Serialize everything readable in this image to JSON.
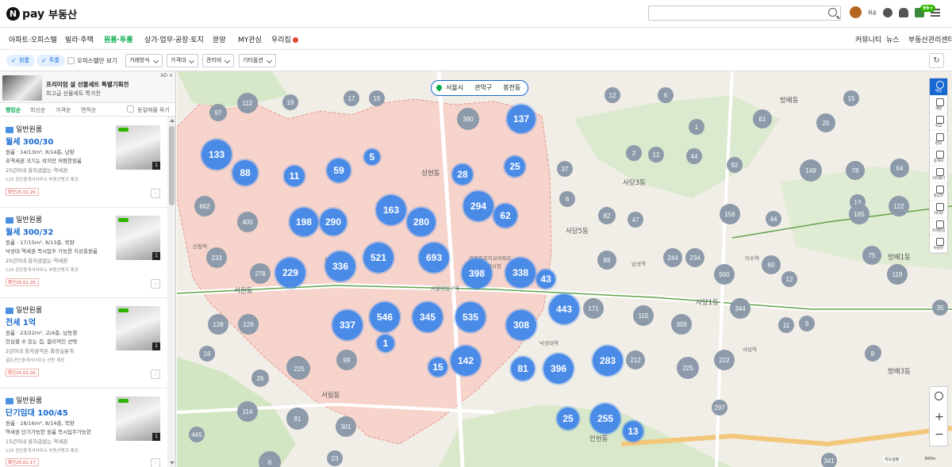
{
  "header": {
    "logo_n": "N",
    "logo_pay": "pay",
    "service": "부동산",
    "user_name": "휘슬",
    "mail_badge": "99+"
  },
  "nav": {
    "tabs": [
      "아파트·오피스텔",
      "빌라·주택",
      "원룸·투룸",
      "상가·업무·공장·토지",
      "분양",
      "MY관심",
      "우리집"
    ],
    "active_tab": "원룸·투룸",
    "right_links": [
      "커뮤니티",
      "뉴스",
      "부동산관리센터"
    ]
  },
  "filters": {
    "chips": [
      "원룸",
      "투룸"
    ],
    "officetel_only": "오피스텔만 보기",
    "dropdowns": [
      "거래방식",
      "가격대",
      "관리비",
      "기타옵션"
    ]
  },
  "ad": {
    "title": "프리미엄 설 선물세트 특별기획전",
    "subtitle": "최고급 선물세트 특가전",
    "tag": "AD ✕"
  },
  "sort": {
    "options": [
      "랭킹순",
      "최신순",
      "가격순",
      "면적순"
    ],
    "active": "랭킹순",
    "group_label": "동일매물 묶기"
  },
  "listings": [
    {
      "badge": "원룸",
      "type": "일반원룸",
      "price": "월세 300/30",
      "spec": "원룸 · 14/13m², 8/14층, 남향",
      "desc": "초역세권 크기는 작지만 저렴한원룸",
      "tags": "25년이내   융자금없는   역세권",
      "agent": "123 공인중개사사무소   부동산뱅크 제공",
      "confirmed": "확인25.01.20.",
      "photo_count": "1"
    },
    {
      "badge": "원룸",
      "type": "일반원룸",
      "price": "월세 300/32",
      "spec": "원룸 · 17/15m², 8/13층, 북향",
      "desc": "낙성대 역세권 즉시입주 가능한 지상층원룸",
      "tags": "25년이내   융자금없는   역세권",
      "agent": "123 공인중개사사무소   부동산뱅크 제공",
      "confirmed": "확인25.01.20.",
      "photo_count": "1"
    },
    {
      "badge": "원룸",
      "type": "일반원룸",
      "price": "전세 1억",
      "spec": "원룸 · 23/22m², 고/4층, 남동향",
      "desc": "안심할 수 있는 집, 합리적인 선택",
      "tags": "2년이내   융자금적은   화장실분개",
      "agent": "골든공인중개사사무소   선방 제공",
      "confirmed": "확인25.01.20.",
      "photo_count": "1"
    },
    {
      "badge": "원룸",
      "type": "일반원룸",
      "price": "단기임대 100/45",
      "spec": "원룸 · 18/16m², 8/14층, 북향",
      "desc": "역세권 단기가능한 원룸 즉시입주가능한",
      "tags": "15년이내   융자금없는   역세권",
      "agent": "123 공인중개사사무소   부동산뱅크 제공",
      "confirmed": "확인25.01.17.",
      "photo_count": "1"
    }
  ],
  "map": {
    "location": [
      "서울시",
      "관악구",
      "봉천동"
    ],
    "clusters_blue": [
      "133",
      "88",
      "11",
      "59",
      "5",
      "28",
      "137",
      "25",
      "198",
      "290",
      "163",
      "280",
      "294",
      "62",
      "229",
      "336",
      "521",
      "693",
      "398",
      "338",
      "43",
      "337",
      "546",
      "345",
      "535",
      "308",
      "443",
      "1",
      "15",
      "142",
      "81",
      "396",
      "283",
      "25",
      "255",
      "13"
    ],
    "clusters_gray": [
      "390",
      "97",
      "112",
      "19",
      "17",
      "15",
      "37",
      "12",
      "2",
      "12",
      "6",
      "1",
      "61",
      "20",
      "15",
      "13",
      "662",
      "400",
      "233",
      "278",
      "6",
      "82",
      "47",
      "44",
      "92",
      "149",
      "78",
      "64",
      "156",
      "44",
      "165",
      "122",
      "129",
      "128",
      "88",
      "244",
      "234",
      "60",
      "12",
      "75",
      "119",
      "16",
      "225",
      "225",
      "560",
      "171",
      "115",
      "309",
      "344",
      "11",
      "9",
      "35",
      "26",
      "225",
      "212",
      "222",
      "8",
      "26",
      "99",
      "114",
      "81",
      "301",
      "445",
      "297",
      "6",
      "23",
      "341",
      "29",
      "6"
    ],
    "labels": {
      "district_seongheon": "성현동",
      "district_sadang3": "사당3동",
      "district_sadang5": "사당5동",
      "district_sadang1": "사당1동",
      "district_seowon": "서원동",
      "district_seorim": "서림동",
      "district_bangbae": "방배동",
      "district_bangbae1": "방배1동",
      "district_bangbae3": "방배3동",
      "district_incheon": "인헌동",
      "station_seoul_univ": "서울대입구역",
      "station_nakseongdae": "낙성대역",
      "station_sadang": "사당역",
      "station_isu": "이수역",
      "station_namseong": "남성역",
      "station_sillim": "신림역",
      "station_bongcheon": "봉천역",
      "place_apt": "관악푸르지오아파트",
      "place_market": "관악봉천시장"
    },
    "scale_left": "지도설정",
    "scale_right": "300m",
    "provider": "NAVER"
  },
  "map_tools": [
    "매물",
    "개발",
    "학교",
    "편의",
    "중개사",
    "거리재기",
    "항공뷰",
    "거리뷰",
    "지적편집",
    "위성뷰"
  ],
  "colors": {
    "brand": "#03a94d",
    "cluster_blue": "#4a8be8",
    "cluster_gray": "#8d9aa9",
    "district_shade": "#f5cfc8",
    "price_blue": "#1769d1"
  }
}
